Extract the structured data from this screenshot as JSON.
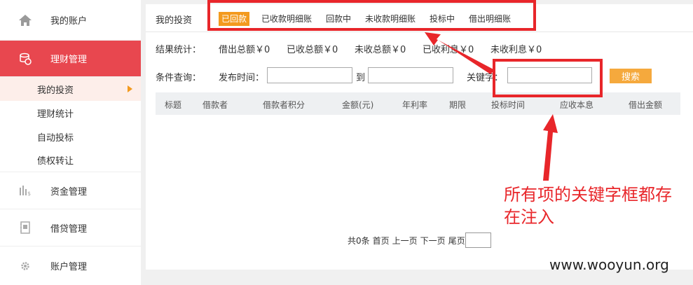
{
  "sidebar": {
    "items": [
      {
        "label": "我的账户",
        "icon": "home-icon"
      },
      {
        "label": "理财管理",
        "icon": "coins-icon"
      },
      {
        "label": "资金管理",
        "icon": "bar-chart-icon"
      },
      {
        "label": "借贷管理",
        "icon": "notebook-icon"
      },
      {
        "label": "账户管理",
        "icon": "gear-icon"
      }
    ],
    "sub_items": [
      {
        "label": "我的投资"
      },
      {
        "label": "理财统计"
      },
      {
        "label": "自动投标"
      },
      {
        "label": "债权转让"
      }
    ]
  },
  "header": {
    "title": "我的投资",
    "tabs": [
      {
        "label": "已回款"
      },
      {
        "label": "已收款明细账"
      },
      {
        "label": "回款中"
      },
      {
        "label": "未收款明细账"
      },
      {
        "label": "投标中"
      },
      {
        "label": "借出明细账"
      }
    ]
  },
  "stats": {
    "label": "结果统计：",
    "items": [
      {
        "text": "借出总额￥0"
      },
      {
        "text": "已收总额￥0"
      },
      {
        "text": "未收总额￥0"
      },
      {
        "text": "已收利息￥0"
      },
      {
        "text": "未收利息￥0"
      }
    ]
  },
  "query": {
    "label": "条件查询：",
    "publish_time_label": "发布时间：",
    "to_label": "到",
    "keyword_label": "关键字：",
    "start_value": "",
    "end_value": "",
    "keyword_value": "",
    "search_label": "搜索"
  },
  "table": {
    "columns": [
      "标题",
      "借款者",
      "借款者积分",
      "金额(元)",
      "年利率",
      "期限",
      "投标时间",
      "应收本息",
      "借出金额"
    ]
  },
  "pager": {
    "total": "共0条",
    "first": "首页",
    "prev": "上一页",
    "next": "下一页",
    "last": "尾页",
    "page_value": ""
  },
  "annotation": {
    "text": "所有项的关键字框都存在注入",
    "color": "#e8262a"
  },
  "watermark": "www.wooyun.org",
  "colors": {
    "accent_red": "#e8474f",
    "tab_orange": "#f39a1f",
    "search_button": "#f5a93d"
  }
}
